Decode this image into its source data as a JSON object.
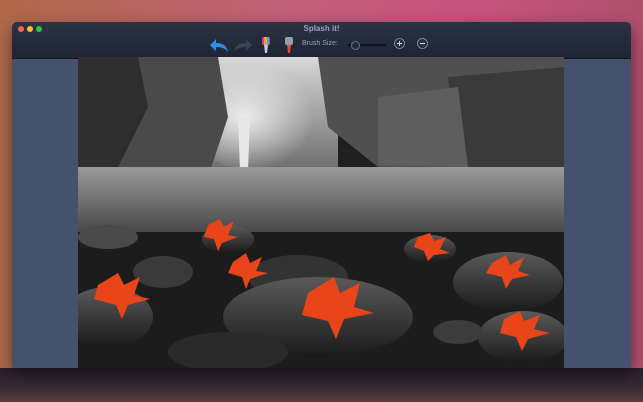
{
  "window": {
    "title": "Splash it!"
  },
  "toolbar": {
    "brush_size_label": "Brush Size:",
    "brush_size_value": 0.1,
    "buttons": [
      {
        "name": "undo",
        "icon": "undo-arrow-icon"
      },
      {
        "name": "redo",
        "icon": "redo-arrow-icon"
      },
      {
        "name": "color-brush",
        "icon": "color-brush-icon"
      },
      {
        "name": "gray-brush",
        "icon": "gray-brush-icon"
      },
      {
        "name": "zoom-in",
        "icon": "zoom-in-icon"
      },
      {
        "name": "zoom-out",
        "icon": "zoom-out-icon"
      }
    ]
  },
  "photo": {
    "description_colors": {
      "foreground_leaves": "#e8461a",
      "background": "#7a7a7a"
    }
  },
  "colors": {
    "accent_undo": "#2e8ef0",
    "window_bg": "#46516d",
    "titlebar_bg": "#1e2432"
  }
}
